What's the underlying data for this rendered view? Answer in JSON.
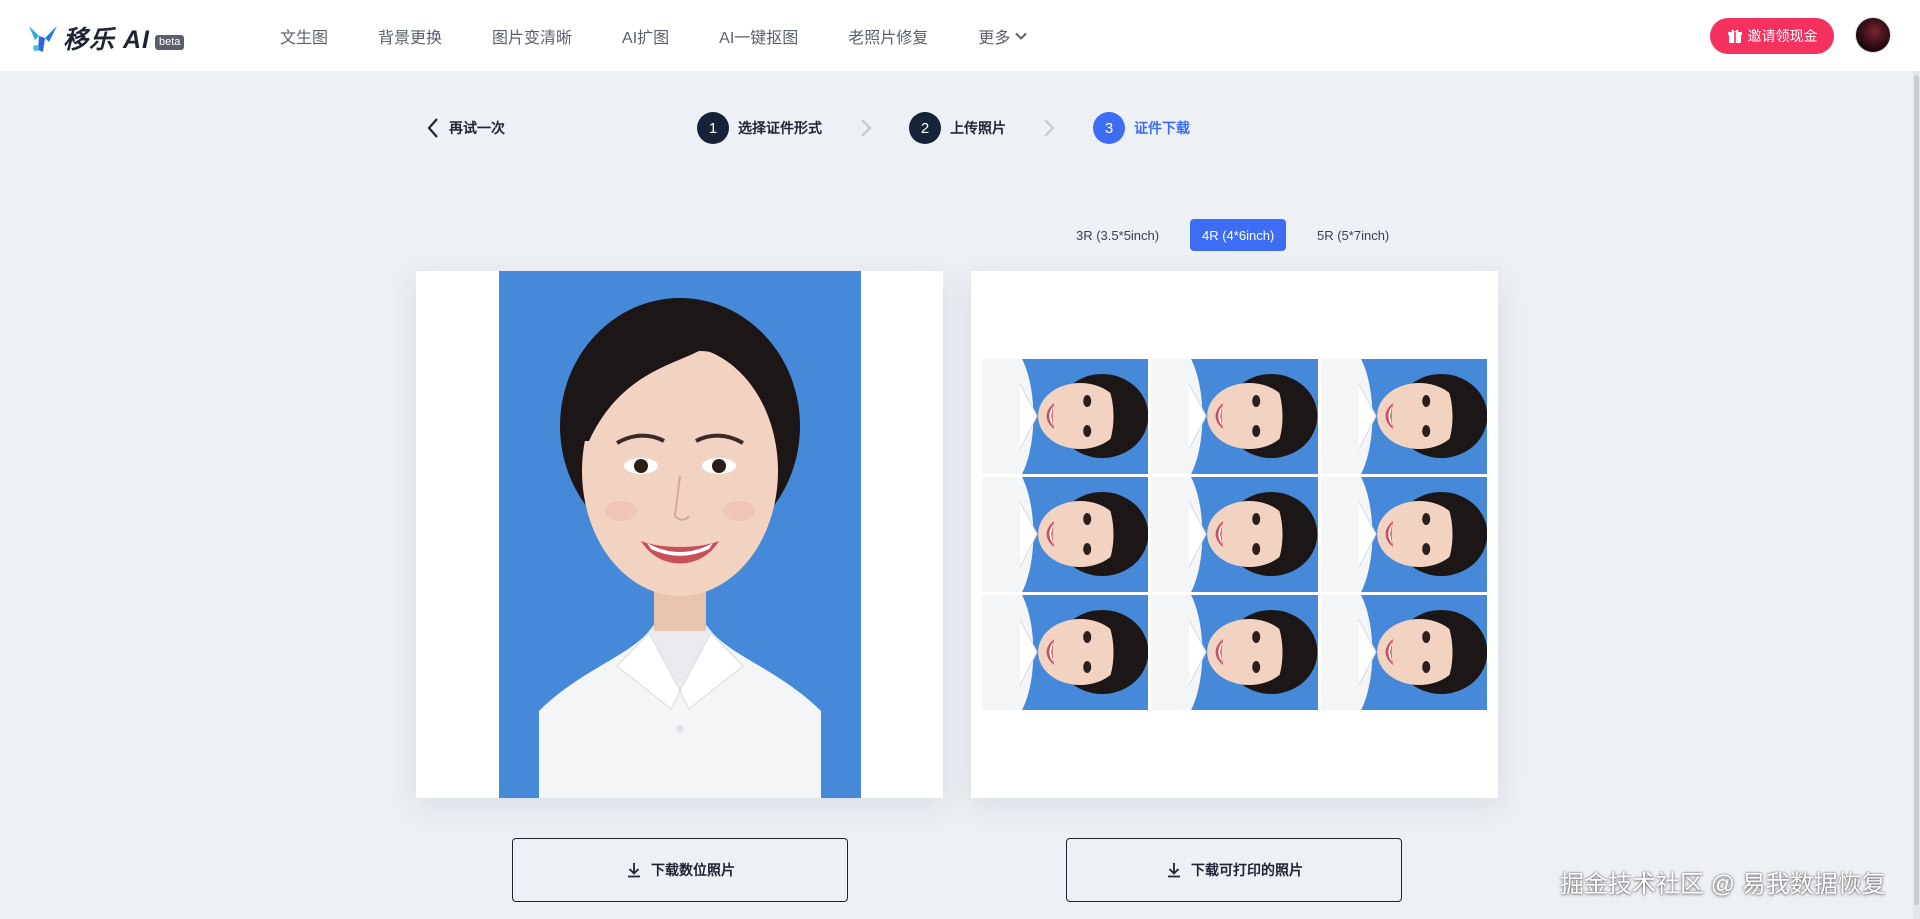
{
  "header": {
    "logo": {
      "name": "移乐 AI",
      "badge": "beta"
    },
    "nav": [
      {
        "label": "文生图"
      },
      {
        "label": "背景更换"
      },
      {
        "label": "图片变清晰"
      },
      {
        "label": "AI扩图"
      },
      {
        "label": "AI一键抠图"
      },
      {
        "label": "老照片修复"
      },
      {
        "label": "更多"
      }
    ],
    "invite_label": "邀请领现金",
    "colors": {
      "invite": "#f5325f",
      "accent": "#3d6df2",
      "step_done": "#152238"
    }
  },
  "steps": {
    "back_label": "再试一次",
    "items": [
      {
        "num": "1",
        "label": "选择证件形式",
        "state": "done"
      },
      {
        "num": "2",
        "label": "上传照片",
        "state": "done"
      },
      {
        "num": "3",
        "label": "证件下载",
        "state": "active"
      }
    ]
  },
  "sizes": {
    "options": [
      {
        "label": "3R (3.5*5inch)"
      },
      {
        "label": "4R (4*6inch)"
      },
      {
        "label": "5R (5*7inch)"
      }
    ],
    "selected": "4R (4*6inch)"
  },
  "photo": {
    "background_color": "#4689d8",
    "print_grid": {
      "rows": 3,
      "cols": 3
    }
  },
  "downloads": {
    "digital_label": "下载数位照片",
    "printable_label": "下载可打印的照片"
  },
  "watermark": "掘金技术社区 @ 易我数据恢复"
}
